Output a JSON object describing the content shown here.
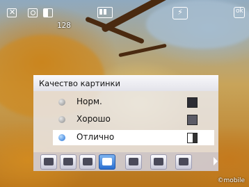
{
  "status": {
    "shot_count": "128",
    "icons": [
      "close-icon",
      "camera-icon",
      "mode-icon",
      "battery-icon",
      "flash-icon",
      "ok-icon"
    ]
  },
  "menu": {
    "title": "Качество картинки",
    "options": [
      {
        "label": "Норм.",
        "selected": false
      },
      {
        "label": "Хорошо",
        "selected": false
      },
      {
        "label": "Отлично",
        "selected": true
      }
    ]
  },
  "toolbar": {
    "items": [
      "scene-icon",
      "landscape-icon",
      "night-icon",
      "quality-icon",
      "effects-icon",
      "zoom-icon",
      "timer-icon"
    ],
    "active_index": 3
  },
  "brand": "©mobile"
}
